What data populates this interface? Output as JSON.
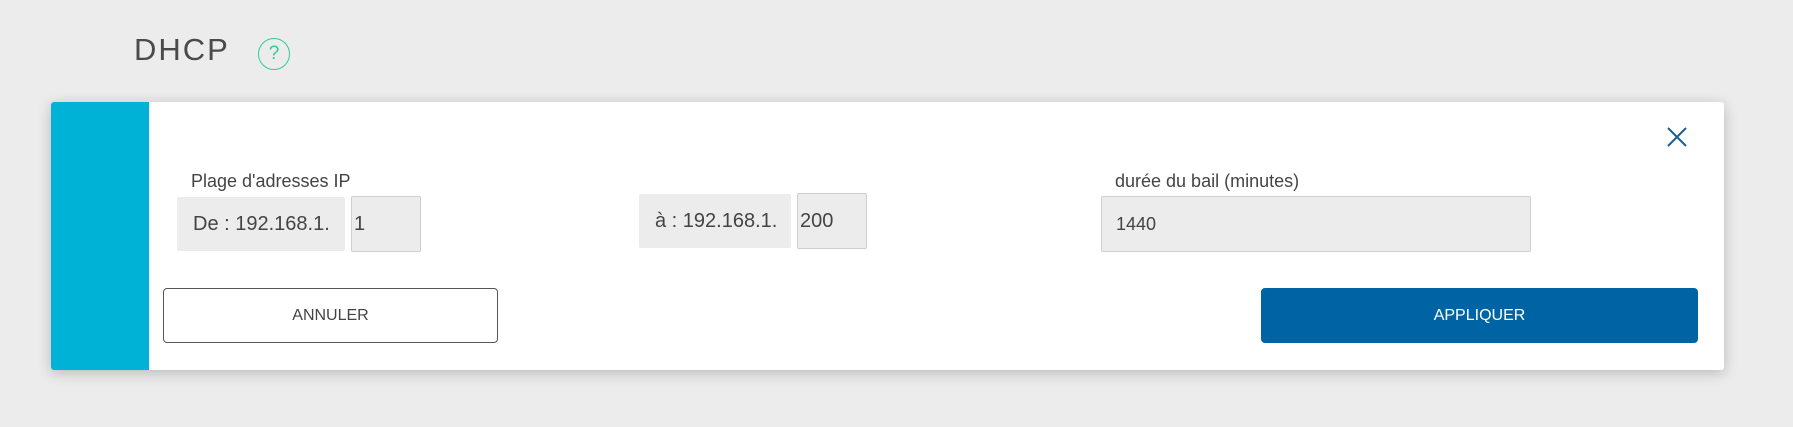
{
  "header": {
    "title": "DHCP",
    "help_label": "?"
  },
  "colors": {
    "accent": "#00b3d6",
    "primary_button": "#0064a4",
    "help_icon": "#2ecc9a",
    "background": "#ececec"
  },
  "form": {
    "range_label": "Plage d'adresses IP",
    "from_prefix": "De : 192.168.1.",
    "from_value": "1",
    "to_prefix": "à : 192.168.1.",
    "to_value": "200",
    "lease_label": "durée du bail (minutes)",
    "lease_value": "1440"
  },
  "actions": {
    "cancel_label": "ANNULER",
    "apply_label": "APPLIQUER"
  },
  "icons": {
    "help": "question-circle-icon",
    "close": "close-icon"
  }
}
